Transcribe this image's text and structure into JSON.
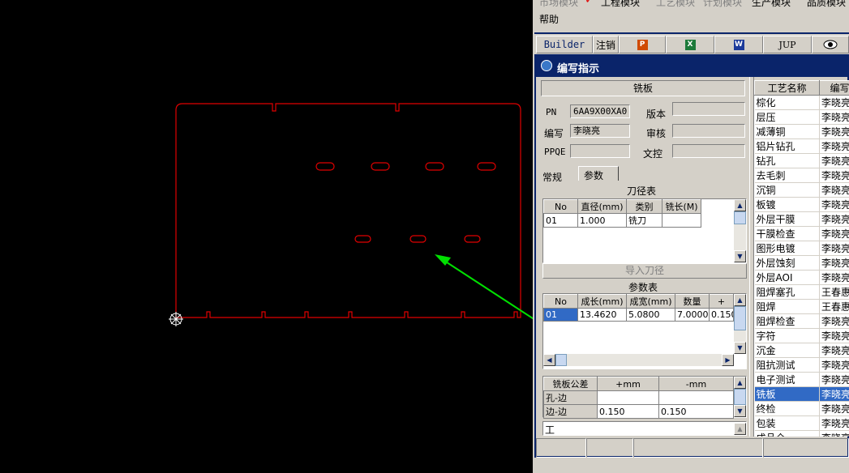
{
  "menu": {
    "items_row1": [
      "市场模块",
      "工程模块",
      "工艺模块",
      "计划模块",
      "生产模块",
      "品质模块"
    ],
    "items_row2": [
      "帮助"
    ],
    "checked_item": "工程模块"
  },
  "toolbar": {
    "builder": "Builder",
    "logout": "注销",
    "ppt_icon": "P",
    "excel_icon": "X",
    "word_icon": "W",
    "jup": "JUP",
    "eye_icon": "eye-icon"
  },
  "dialog": {
    "title": "编写指示",
    "header": "铣板",
    "pn_label": "PN",
    "pn_value": "6AA9X00XA0",
    "version_label": "版本",
    "version_value": "",
    "author_label": "编写",
    "author_value": "李晓亮",
    "review_label": "审核",
    "review_value": "",
    "ppqe_label": "PPQE",
    "ppqe_value": "",
    "doc_label": "文控",
    "doc_value": "",
    "tabs": [
      "常规",
      "参数"
    ],
    "active_tab": "参数",
    "tool_table": {
      "title": "刀径表",
      "headers": [
        "No",
        "直径(mm)",
        "类别",
        "铣长(M)"
      ],
      "rows": [
        [
          "01",
          "1.000",
          "铣刀",
          ""
        ]
      ]
    },
    "import_button": "导入刀径",
    "param_table": {
      "title": "参数表",
      "headers": [
        "No",
        "成长(mm)",
        "成宽(mm)",
        "数量",
        "+"
      ],
      "rows": [
        [
          "01",
          "13.4620",
          "5.0800",
          "7.0000",
          "0.150"
        ]
      ]
    },
    "tolerance_table": {
      "headers": [
        "铣板公差",
        "+mm",
        "-mm"
      ],
      "rows": [
        [
          "孔-边",
          "",
          ""
        ],
        [
          "边-边",
          "0.150",
          "0.150"
        ]
      ]
    },
    "bottom_label": "工"
  },
  "process_list": {
    "headers": [
      "工艺名称",
      "编写"
    ],
    "rows": [
      [
        "棕化",
        "李晓亮"
      ],
      [
        "层压",
        "李晓亮"
      ],
      [
        "减薄铜",
        "李晓亮"
      ],
      [
        "铝片钻孔",
        "李晓亮"
      ],
      [
        "钻孔",
        "李晓亮"
      ],
      [
        "去毛刺",
        "李晓亮"
      ],
      [
        "沉铜",
        "李晓亮"
      ],
      [
        "板镀",
        "李晓亮"
      ],
      [
        "外层干膜",
        "李晓亮"
      ],
      [
        "干膜检查",
        "李晓亮"
      ],
      [
        "图形电镀",
        "李晓亮"
      ],
      [
        "外层蚀刻",
        "李晓亮"
      ],
      [
        "外层AOI",
        "李晓亮"
      ],
      [
        "阻焊塞孔",
        "王春惠"
      ],
      [
        "阻焊",
        "王春惠"
      ],
      [
        "阻焊检查",
        "李晓亮"
      ],
      [
        "字符",
        "李晓亮"
      ],
      [
        "沉金",
        "李晓亮"
      ],
      [
        "阻抗测试",
        "李晓亮"
      ],
      [
        "电子测试",
        "李晓亮"
      ],
      [
        "铣板",
        "李晓亮"
      ],
      [
        "终检",
        "李晓亮"
      ],
      [
        "包装",
        "李晓亮"
      ],
      [
        "成品仓",
        "李晓亮"
      ]
    ],
    "selected": "铣板"
  },
  "colors": {
    "cad_outline": "#e00000",
    "arrow": "#00e000",
    "title_bar": "#0a246a",
    "selection": "#316ac5"
  }
}
